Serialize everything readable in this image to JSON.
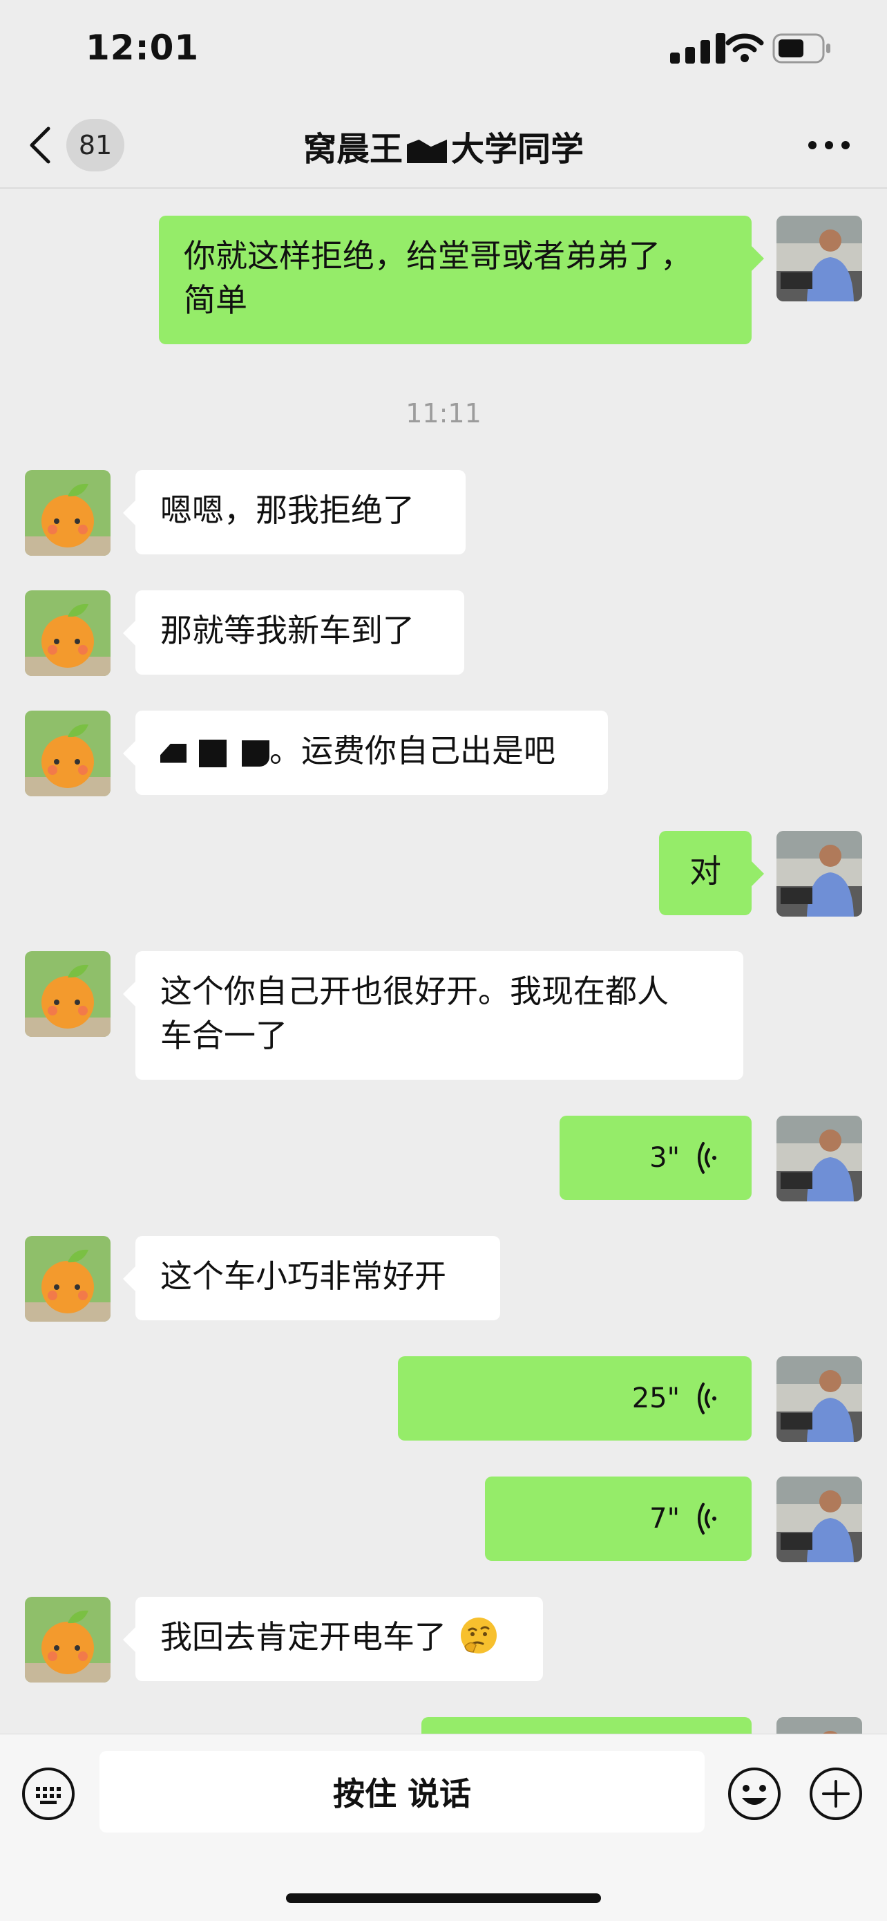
{
  "status": {
    "time": "12:01"
  },
  "header": {
    "unread_count": "81",
    "title_pre": "窝晨王",
    "title_post": "大学同学"
  },
  "messages": {
    "m1": {
      "line1": "你就这样拒绝，给堂哥或者弟弟了，",
      "line2": "简单"
    },
    "timestamp": "11:11",
    "m2": "嗯嗯，那我拒绝了",
    "m3": "那就等我新车到了",
    "m4_suffix": "。运费你自己出是吧",
    "m5": "对",
    "m6": {
      "line1": "这个你自己开也很好开。我现在都人",
      "line2": "车合一了"
    },
    "v1": "3\"",
    "m7": "这个车小巧非常好开",
    "v2": "25\"",
    "v3": "7\"",
    "m8": "我回去肯定开电车了"
  },
  "input": {
    "hold_to_talk": "按住 说话"
  },
  "colors": {
    "out_bubble": "#95ec69",
    "in_bubble": "#ffffff",
    "background": "#ededed"
  },
  "icons": [
    "back-icon",
    "more-icon",
    "keyboard-icon",
    "emoji-icon",
    "plus-icon",
    "voice-wave-icon",
    "thinking-emoji-icon",
    "signal-icon",
    "wifi-icon",
    "battery-icon"
  ]
}
